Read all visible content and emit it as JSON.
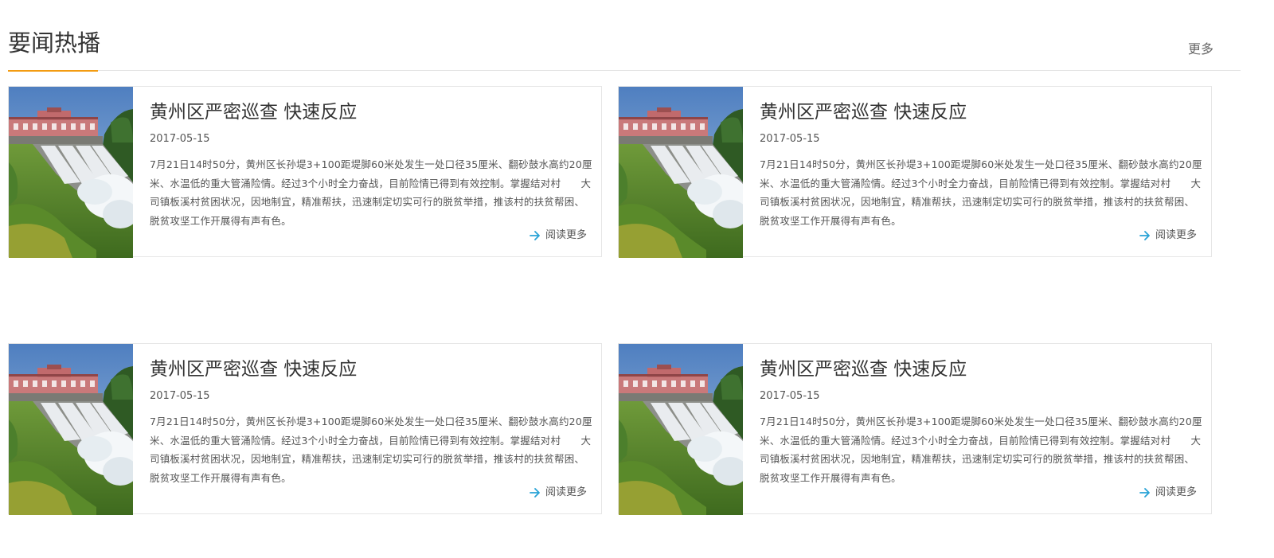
{
  "section": {
    "title": "要闻热播",
    "more_label": "更多"
  },
  "colors": {
    "accent_underline": "#f39c12",
    "arrow": "#29a3d6"
  },
  "news": [
    {
      "title": "黄州区严密巡查 快速反应",
      "date": "2017-05-15",
      "summary": "7月21日14时50分，黄州区长孙堤3+100距堤脚60米处发生一处口径35厘米、翻砂鼓水高约20厘米、水温低的重大管涌险情。经过3个小时全力奋战，目前险情已得到有效控制。掌握结对村　　大司镇板溪村贫困状况，因地制宜，精准帮扶，迅速制定切实可行的脱贫举措，推该村的扶贫帮困、脱贫攻坚工作开展得有声有色。",
      "read_more": "阅读更多",
      "thumb_icon": "dam-spillway-photo"
    },
    {
      "title": "黄州区严密巡查 快速反应",
      "date": "2017-05-15",
      "summary": "7月21日14时50分，黄州区长孙堤3+100距堤脚60米处发生一处口径35厘米、翻砂鼓水高约20厘米、水温低的重大管涌险情。经过3个小时全力奋战，目前险情已得到有效控制。掌握结对村　　大司镇板溪村贫困状况，因地制宜，精准帮扶，迅速制定切实可行的脱贫举措，推该村的扶贫帮困、脱贫攻坚工作开展得有声有色。",
      "read_more": "阅读更多",
      "thumb_icon": "dam-spillway-photo"
    },
    {
      "title": "黄州区严密巡查 快速反应",
      "date": "2017-05-15",
      "summary": "7月21日14时50分，黄州区长孙堤3+100距堤脚60米处发生一处口径35厘米、翻砂鼓水高约20厘米、水温低的重大管涌险情。经过3个小时全力奋战，目前险情已得到有效控制。掌握结对村　　大司镇板溪村贫困状况，因地制宜，精准帮扶，迅速制定切实可行的脱贫举措，推该村的扶贫帮困、脱贫攻坚工作开展得有声有色。",
      "read_more": "阅读更多",
      "thumb_icon": "dam-spillway-photo"
    },
    {
      "title": "黄州区严密巡查 快速反应",
      "date": "2017-05-15",
      "summary": "7月21日14时50分，黄州区长孙堤3+100距堤脚60米处发生一处口径35厘米、翻砂鼓水高约20厘米、水温低的重大管涌险情。经过3个小时全力奋战，目前险情已得到有效控制。掌握结对村　　大司镇板溪村贫困状况，因地制宜，精准帮扶，迅速制定切实可行的脱贫举措，推该村的扶贫帮困、脱贫攻坚工作开展得有声有色。",
      "read_more": "阅读更多",
      "thumb_icon": "dam-spillway-photo"
    }
  ]
}
